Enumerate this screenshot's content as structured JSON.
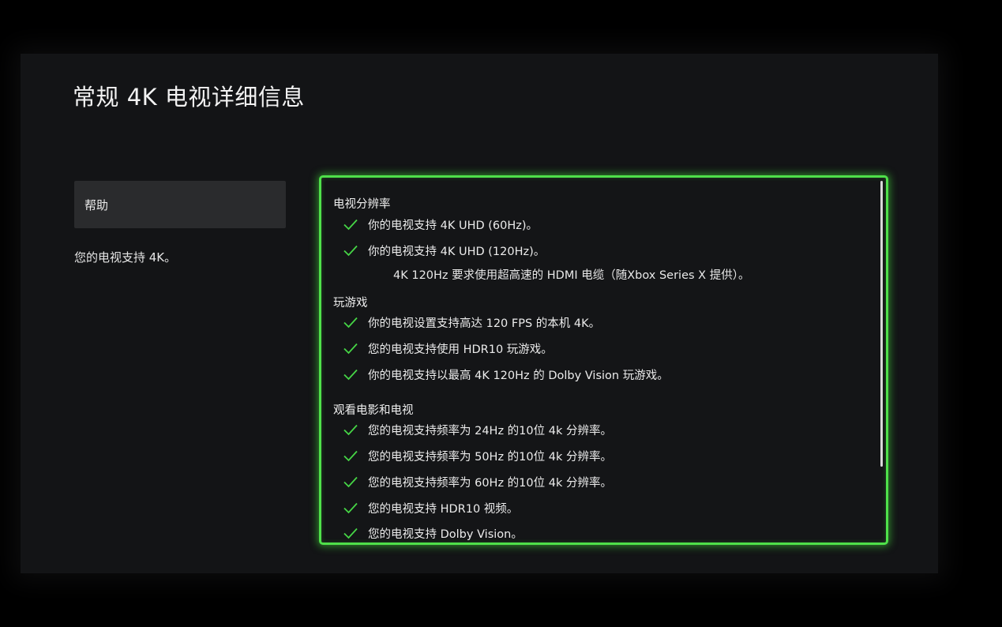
{
  "page": {
    "title": "常规 4K 电视详细信息"
  },
  "sidebar": {
    "help_label": "帮助",
    "description": "您的电视支持 4K。"
  },
  "details": {
    "sections": [
      {
        "heading": "电视分辨率",
        "items": [
          "你的电视支持 4K UHD (60Hz)。",
          "你的电视支持 4K UHD (120Hz)。"
        ],
        "note": "4K 120Hz 要求使用超高速的 HDMI 电缆（随Xbox Series X 提供）。"
      },
      {
        "heading": "玩游戏",
        "items": [
          "你的电视设置支持高达 120 FPS 的本机 4K。",
          "您的电视支持使用 HDR10 玩游戏。",
          "你的电视支持以最高 4K 120Hz 的 Dolby Vision 玩游戏。"
        ]
      },
      {
        "heading": "观看电影和电视",
        "items": [
          "您的电视支持频率为 24Hz 的10位 4k 分辨率。",
          "您的电视支持频率为 50Hz 的10位 4k 分辨率。",
          "您的电视支持频率为 60Hz 的10位 4k 分辨率。",
          "您的电视支持 HDR10 视频。",
          "您的电视支持 Dolby Vision。"
        ]
      }
    ]
  },
  "colors": {
    "accent": "#4fe04a",
    "check": "#46d646",
    "background": "#131416"
  },
  "icons": {
    "check": "check-icon"
  }
}
